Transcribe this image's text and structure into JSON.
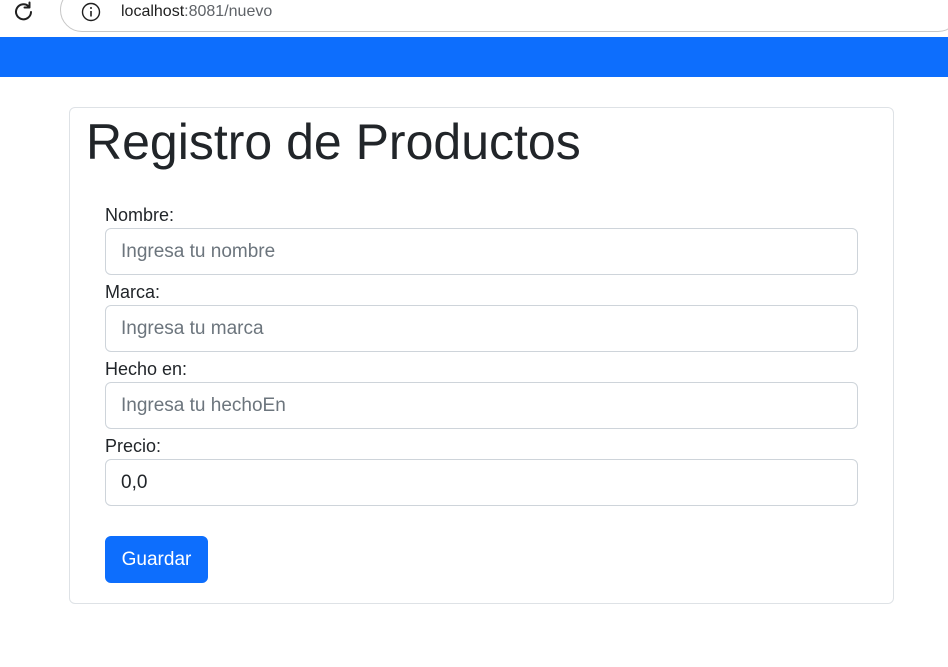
{
  "browser": {
    "url_host": "localhost",
    "url_rest": ":8081/nuevo"
  },
  "page": {
    "title": "Registro de Productos"
  },
  "form": {
    "nombre": {
      "label": "Nombre:",
      "placeholder": "Ingresa tu nombre",
      "value": ""
    },
    "marca": {
      "label": "Marca:",
      "placeholder": "Ingresa tu marca",
      "value": ""
    },
    "hecho_en": {
      "label": "Hecho en:",
      "placeholder": "Ingresa tu hechoEn",
      "value": ""
    },
    "precio": {
      "label": "Precio:",
      "placeholder": "",
      "value": "0,0"
    },
    "submit_label": "Guardar"
  },
  "colors": {
    "primary": "#0d6efd",
    "text": "#212529",
    "placeholder": "#6c757d",
    "border": "#ced4da"
  },
  "icons": {
    "reload": "reload-icon",
    "info": "info-icon"
  }
}
